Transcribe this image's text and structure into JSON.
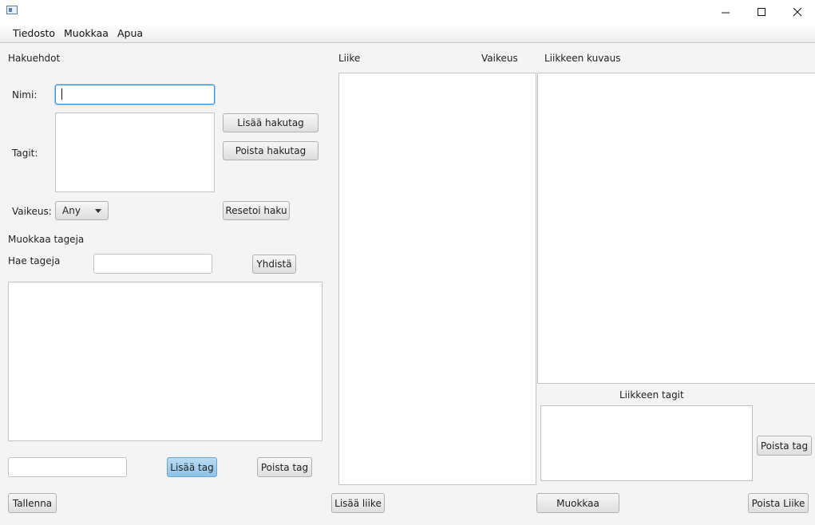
{
  "menubar": {
    "items": [
      "Tiedosto",
      "Muokkaa",
      "Apua"
    ]
  },
  "search": {
    "heading": "Hakuehdot",
    "name_label": "Nimi:",
    "name_value": "",
    "tags_label": "Tagit:",
    "add_tag_button": "Lisää hakutag",
    "remove_tag_button": "Poista hakutag",
    "difficulty_label": "Vaikeus:",
    "difficulty_value": "Any",
    "reset_button": "Resetoi haku"
  },
  "edit_tags": {
    "heading": "Muokkaa tageja",
    "search_label": "Hae tageja",
    "search_value": "",
    "merge_button": "Yhdistä",
    "new_tag_value": "",
    "add_button": "Lisää tag",
    "remove_button": "Poista tag"
  },
  "save_button": "Tallenna",
  "moves": {
    "col_move": "Liike",
    "col_difficulty": "Vaikeus",
    "add_button": "Lisää liike"
  },
  "details": {
    "description_heading": "Liikkeen kuvaus",
    "tags_heading": "Liikkeen tagit",
    "remove_tag_button": "Poista tag",
    "edit_button": "Muokkaa",
    "remove_move_button": "Poista Liike"
  },
  "colors": {
    "accent": "#3d8fd6",
    "primary_button": "#a6d0ee"
  }
}
